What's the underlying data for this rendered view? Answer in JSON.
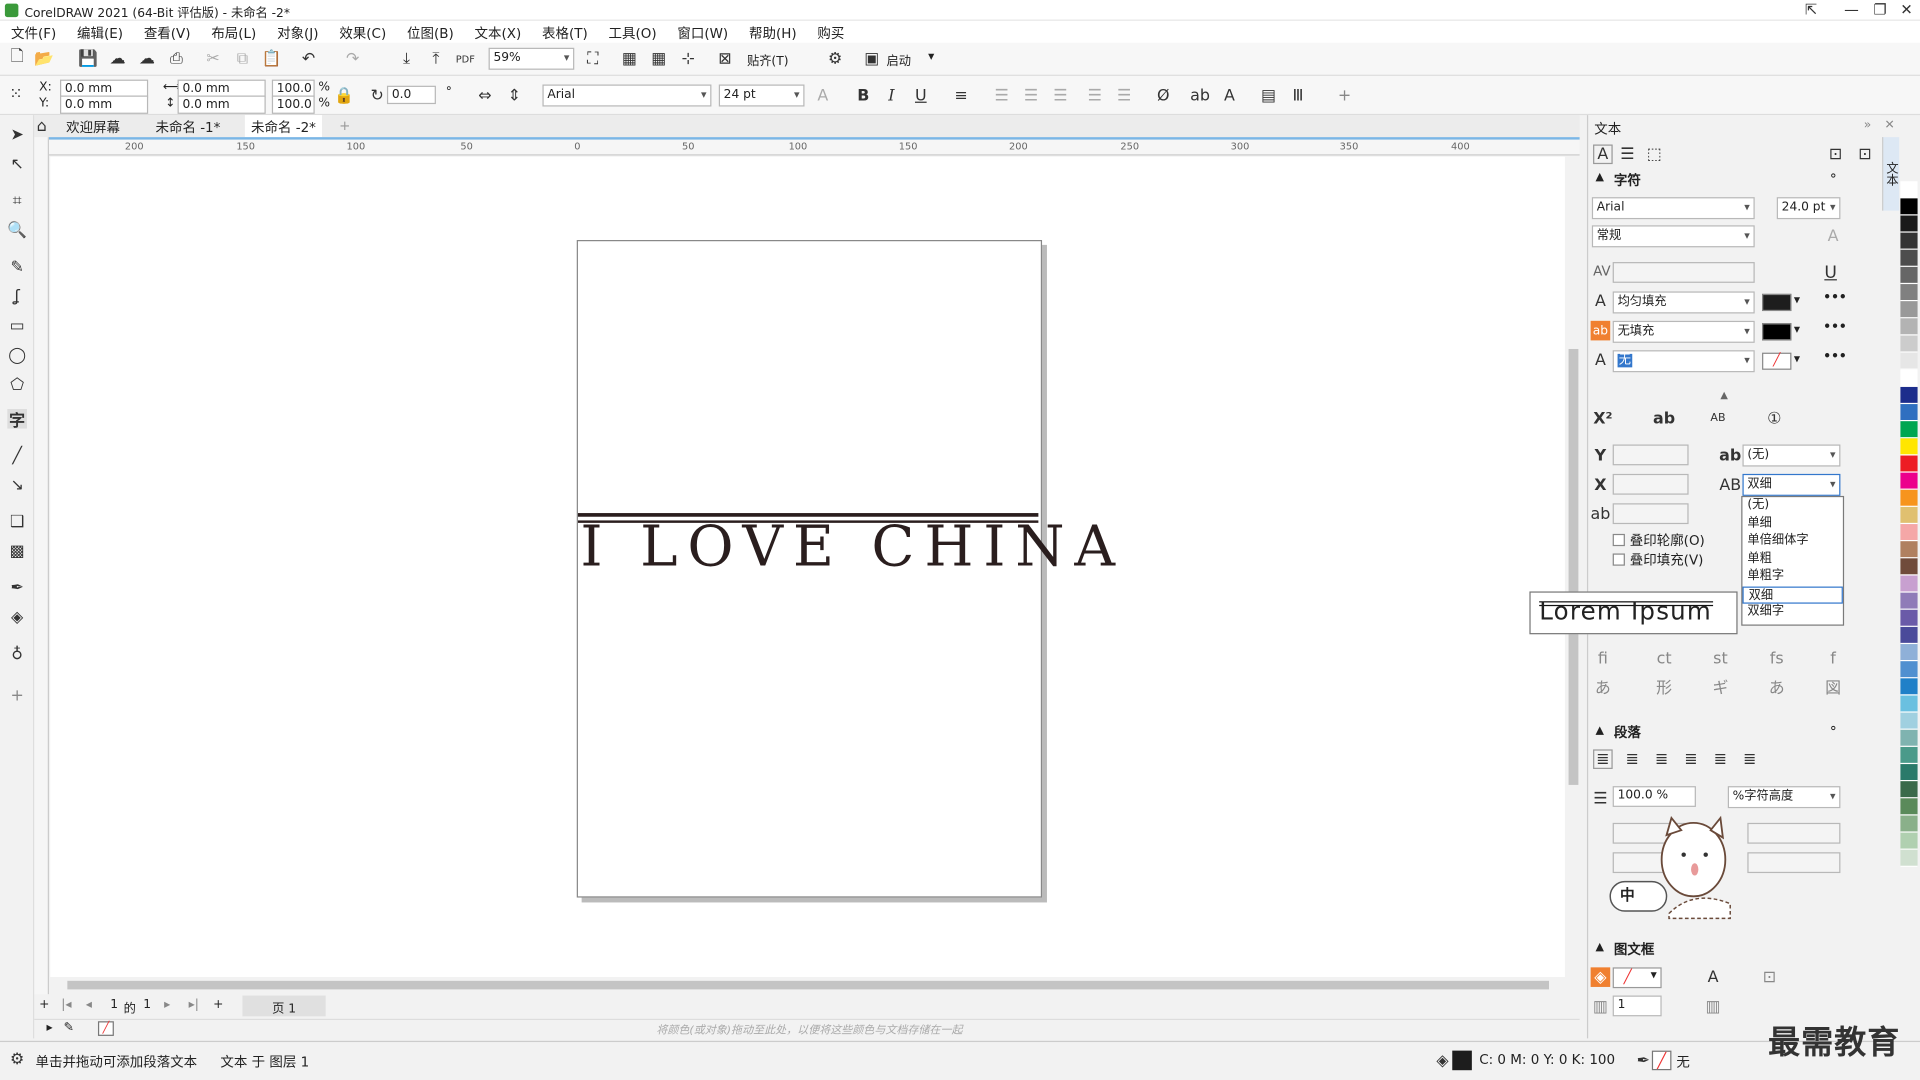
{
  "window": {
    "title": "CorelDRAW 2021 (64-Bit 评估版) - 未命名 -2*"
  },
  "menu": [
    "文件(F)",
    "编辑(E)",
    "查看(V)",
    "布局(L)",
    "对象(J)",
    "效果(C)",
    "位图(B)",
    "文本(X)",
    "表格(T)",
    "工具(O)",
    "窗口(W)",
    "帮助(H)",
    "购买"
  ],
  "standard_toolbar": {
    "zoom": "59%",
    "snap_label": "贴齐(T)",
    "launch_label": "启动"
  },
  "property_bar": {
    "x_label": "X:",
    "x_value": "0.0 mm",
    "y_label": "Y:",
    "y_value": "0.0 mm",
    "w_value": "0.0 mm",
    "h_value": "0.0 mm",
    "scale_w": "100.0",
    "scale_h": "100.0",
    "pct": "%",
    "rotation": "0.0",
    "font": "Arial",
    "font_size": "24 pt"
  },
  "tabs": [
    "欢迎屏幕",
    "未命名 -1*",
    "未命名 -2*"
  ],
  "ruler_h": [
    "200",
    "150",
    "100",
    "50",
    "0",
    "50",
    "100",
    "150",
    "200",
    "250",
    "300",
    "350",
    "400"
  ],
  "canvas": {
    "text": "I LOVE CHINA"
  },
  "page_nav": {
    "current": "1",
    "of": "的",
    "total": "1",
    "page_tab": "页 1"
  },
  "palette_hint": "将颜色(或对象)拖动至此处，以便将这些颜色与文档存储在一起",
  "status": {
    "hint": "单击并拖动可添加段落文本",
    "layer": "文本 于 图层 1",
    "cmyk": "C: 0 M: 0 Y: 0 K: 100",
    "fill_none": "无"
  },
  "docker": {
    "title": "文本",
    "char_section": "字符",
    "font": "Arial",
    "size": "24.0 pt",
    "style": "常规",
    "fill_type": "均匀填充",
    "bg_fill": "无填充",
    "outline": "无",
    "pos_none": "(无)",
    "underline_value": "双细",
    "overprint_outline": "叠印轮廓(O)",
    "overprint_fill": "叠印填充(V)",
    "para_section": "段落",
    "line_spacing": "100.0 %",
    "line_unit": "%字符高度",
    "frame_section": "图文框",
    "frame_cols": "1"
  },
  "underline_options": [
    "(无)",
    "单细",
    "单倍细体字",
    "单粗",
    "单粗字",
    "双细",
    "双细字"
  ],
  "preview_text": "Lorem Ipsum",
  "watermark": "最需教育",
  "colors": {
    "accent": "#3377cc",
    "text_dark": "#2a1e1e"
  },
  "palette": [
    "#ffffff",
    "#000000",
    "#1a1a1a",
    "#333333",
    "#4d4d4d",
    "#666666",
    "#808080",
    "#999999",
    "#b3b3b3",
    "#cccccc",
    "#e6e6e6",
    "#ffffff",
    "#1c2d8c",
    "#2f6fc0",
    "#00a651",
    "#ffe600",
    "#ed1c24",
    "#ec008c",
    "#f7941d",
    "#e0c070",
    "#f5a7a7",
    "#b08060",
    "#704b3b",
    "#c8a0d0",
    "#8f7bb8",
    "#6a5aa8",
    "#4a4a9a",
    "#8fb0d8",
    "#5090d0",
    "#2080c8",
    "#6ac0e0",
    "#a0d0e0",
    "#7fb3b0",
    "#4a9a8a",
    "#2a7a6a",
    "#3a6a4a",
    "#5a8a5a",
    "#8ab08a",
    "#b0d0b0",
    "#d0e0d0"
  ]
}
